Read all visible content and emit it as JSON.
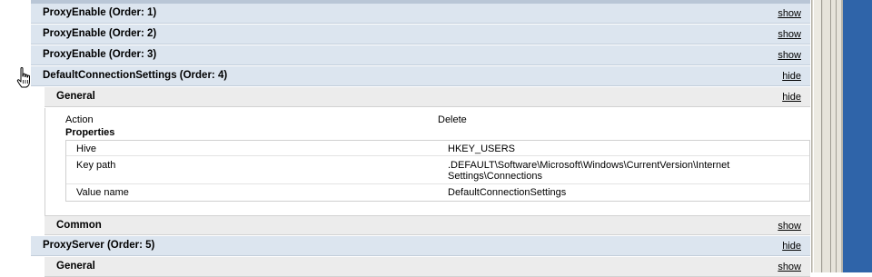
{
  "policy_items": [
    {
      "title": "ProxyEnable (Order: 1)",
      "toggle": "show"
    },
    {
      "title": "ProxyEnable (Order: 2)",
      "toggle": "show"
    },
    {
      "title": "ProxyEnable (Order: 3)",
      "toggle": "show"
    },
    {
      "title": "DefaultConnectionSettings (Order: 4)",
      "toggle": "hide"
    },
    {
      "title": "ProxyServer (Order: 5)",
      "toggle": "hide"
    }
  ],
  "order4_sections": {
    "general": {
      "title": "General",
      "toggle": "hide"
    },
    "common": {
      "title": "Common",
      "toggle": "show"
    }
  },
  "order5_sections": {
    "general": {
      "title": "General",
      "toggle": "show"
    }
  },
  "general_details": {
    "action_label": "Action",
    "action_value": "Delete",
    "properties_label": "Properties",
    "properties": [
      {
        "key": "Hive",
        "value": "HKEY_USERS"
      },
      {
        "key": "Key path",
        "value": ".DEFAULT\\Software\\Microsoft\\Windows\\CurrentVersion\\Internet Settings\\Connections"
      },
      {
        "key": "Value name",
        "value": "DefaultConnectionSettings"
      }
    ]
  },
  "colors": {
    "bar_blue": "#dce5ef",
    "sub_gray": "#ececec",
    "desktop_blue": "#2f64a9"
  },
  "icons": {
    "cursor": "hand-pointer-icon"
  }
}
